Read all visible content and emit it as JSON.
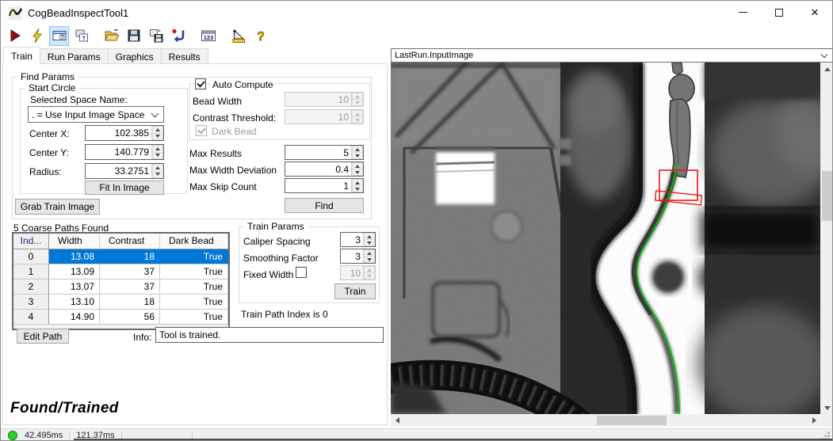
{
  "colors": {
    "sel": "#0078d7",
    "green": "#2bd42b",
    "or": "#ef1313",
    "og": "#00c200",
    "tbsel": "#cfe8fc"
  },
  "window": {
    "title": "CogBeadInspectTool1"
  },
  "toolbar": {
    "icons": [
      "run",
      "electric-run",
      "tool-edit-window",
      "floating-window",
      "open-file",
      "save",
      "save-as",
      "reset",
      "show-record-numbers",
      "measure",
      "help"
    ]
  },
  "tabs": {
    "items": [
      "Train",
      "Run Params",
      "Graphics",
      "Results"
    ],
    "active": "Train"
  },
  "train_tab": {
    "find_params": {
      "title": "Find Params",
      "start_circle": {
        "title": "Start Circle",
        "space_label": "Selected Space Name:",
        "space_value": ". = Use Input Image Space",
        "center_x_label": "Center X:",
        "center_x": "102.385",
        "center_y_label": "Center Y:",
        "center_y": "140.779",
        "radius_label": "Radius:",
        "radius": "33.2751",
        "fit_button": "Fit In Image"
      },
      "auto_compute": {
        "title": "Auto Compute",
        "bead_width_label": "Bead Width",
        "bead_width": "10",
        "contrast_label": "Contrast Threshold:",
        "contrast": "10",
        "dark_bead_label": "Dark Bead"
      },
      "max_results_label": "Max Results",
      "max_results": "5",
      "max_width_dev_label": "Max Width Deviation",
      "max_width_dev": "0.4",
      "max_skip_label": "Max Skip Count",
      "max_skip": "1",
      "find_button": "Find",
      "grab_button": "Grab Train Image"
    },
    "paths_table": {
      "caption": "5 Coarse Paths Found",
      "columns": [
        "Ind...",
        "Width",
        "Contrast",
        "Dark Bead"
      ],
      "rows": [
        [
          "0",
          "13.08",
          "18",
          "True"
        ],
        [
          "1",
          "13.09",
          "37",
          "True"
        ],
        [
          "2",
          "13.07",
          "37",
          "True"
        ],
        [
          "3",
          "13.10",
          "18",
          "True"
        ],
        [
          "4",
          "14.90",
          "56",
          "True"
        ]
      ],
      "selected_row": 0
    },
    "train_params": {
      "title": "Train Params",
      "caliper_label": "Caliper Spacing",
      "caliper": "3",
      "smoothing_label": "Smoothing Factor",
      "smoothing": "3",
      "fixed_width_label": "Fixed Width",
      "fixed_width": "10",
      "train_button": "Train",
      "index_note": "Train Path Index is 0"
    },
    "edit_path_button": "Edit Path",
    "info_label": "Info:",
    "info_value": "Tool is trained.",
    "state_text": "Found/Trained"
  },
  "status_bar": {
    "run_time": "42.495ms",
    "total_time": "121.37ms"
  },
  "image_panel": {
    "selector": "LastRun.InputImage"
  }
}
